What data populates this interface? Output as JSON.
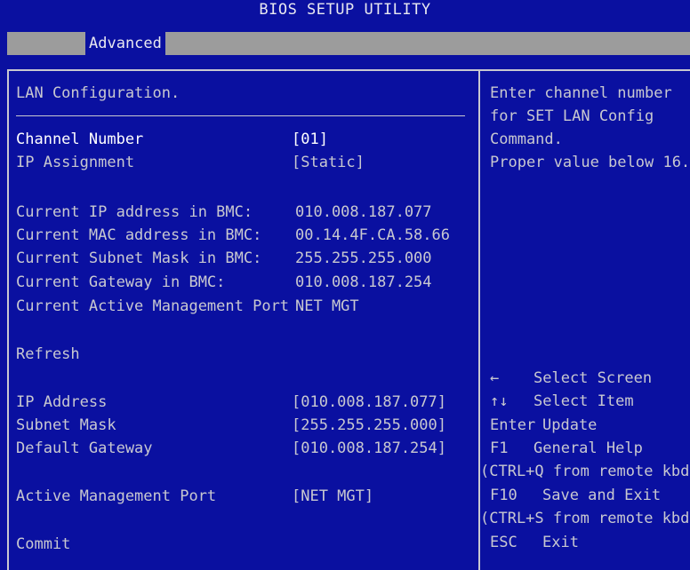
{
  "window": {
    "title": "BIOS SETUP UTILITY"
  },
  "menu": {
    "active_tab": "Advanced"
  },
  "section": {
    "title": "LAN Configuration."
  },
  "settings": [
    {
      "label": "Channel Number",
      "value": "[01]",
      "selected": true
    },
    {
      "label": "IP Assignment",
      "value": "[Static]"
    }
  ],
  "info": [
    {
      "label": "Current IP address in BMC:",
      "value": "010.008.187.077"
    },
    {
      "label": "Current MAC address in BMC:",
      "value": "00.14.4F.CA.58.66"
    },
    {
      "label": "Current Subnet Mask in BMC:",
      "value": "255.255.255.000"
    },
    {
      "label": "Current Gateway in BMC:",
      "value": "010.008.187.254"
    },
    {
      "label": "Current Active Management Port",
      "value": "NET MGT"
    }
  ],
  "actions": {
    "refresh": "Refresh",
    "commit": "Commit"
  },
  "network": [
    {
      "label": "IP Address",
      "value": "[010.008.187.077]"
    },
    {
      "label": "Subnet Mask",
      "value": "[255.255.255.000]"
    },
    {
      "label": "Default Gateway",
      "value": "[010.008.187.254]"
    }
  ],
  "mgmt_port": {
    "label": "Active Management Port",
    "value": "[NET MGT]"
  },
  "help_text": [
    "Enter channel number",
    "for SET LAN Config",
    "Command.",
    "Proper value below 16."
  ],
  "keys": [
    {
      "key": "←",
      "desc": "Select Screen"
    },
    {
      "key": "↑↓",
      "desc": "Select Item"
    },
    {
      "key": "Enter",
      "desc": "Update"
    },
    {
      "key": "F1",
      "desc": "General Help"
    },
    {
      "key": "",
      "desc": "(CTRL+Q from remote kbd)"
    },
    {
      "key": "F10",
      "desc": "Save and Exit"
    },
    {
      "key": "",
      "desc": "(CTRL+S from remote kbd)"
    },
    {
      "key": "ESC",
      "desc": "Exit"
    }
  ]
}
